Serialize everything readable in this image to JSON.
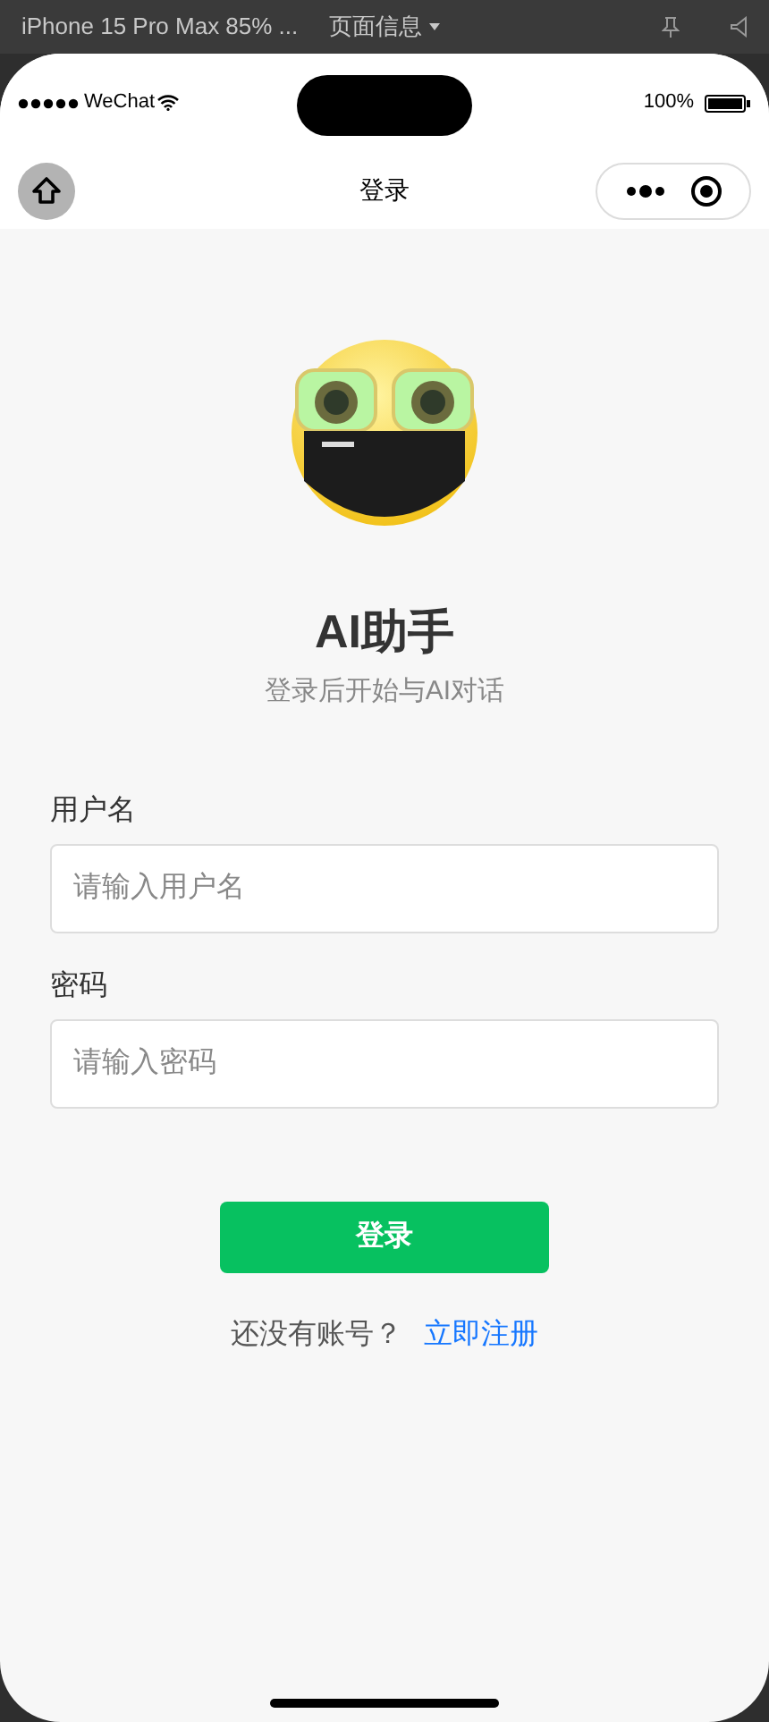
{
  "devtools_bar": {
    "device": "iPhone 15 Pro Max 85% ...",
    "page_info": "页面信息"
  },
  "status_bar": {
    "carrier": "WeChat",
    "battery": "100%"
  },
  "nav_bar": {
    "title": "登录"
  },
  "header": {
    "title": "AI助手",
    "subtitle": "登录后开始与AI对话"
  },
  "form": {
    "fields": [
      {
        "label": "用户名",
        "placeholder": "请输入用户名"
      },
      {
        "label": "密码",
        "placeholder": "请输入密码"
      }
    ],
    "submit": "登录",
    "register_prompt": "还没有账号？",
    "register_link": "立即注册"
  }
}
